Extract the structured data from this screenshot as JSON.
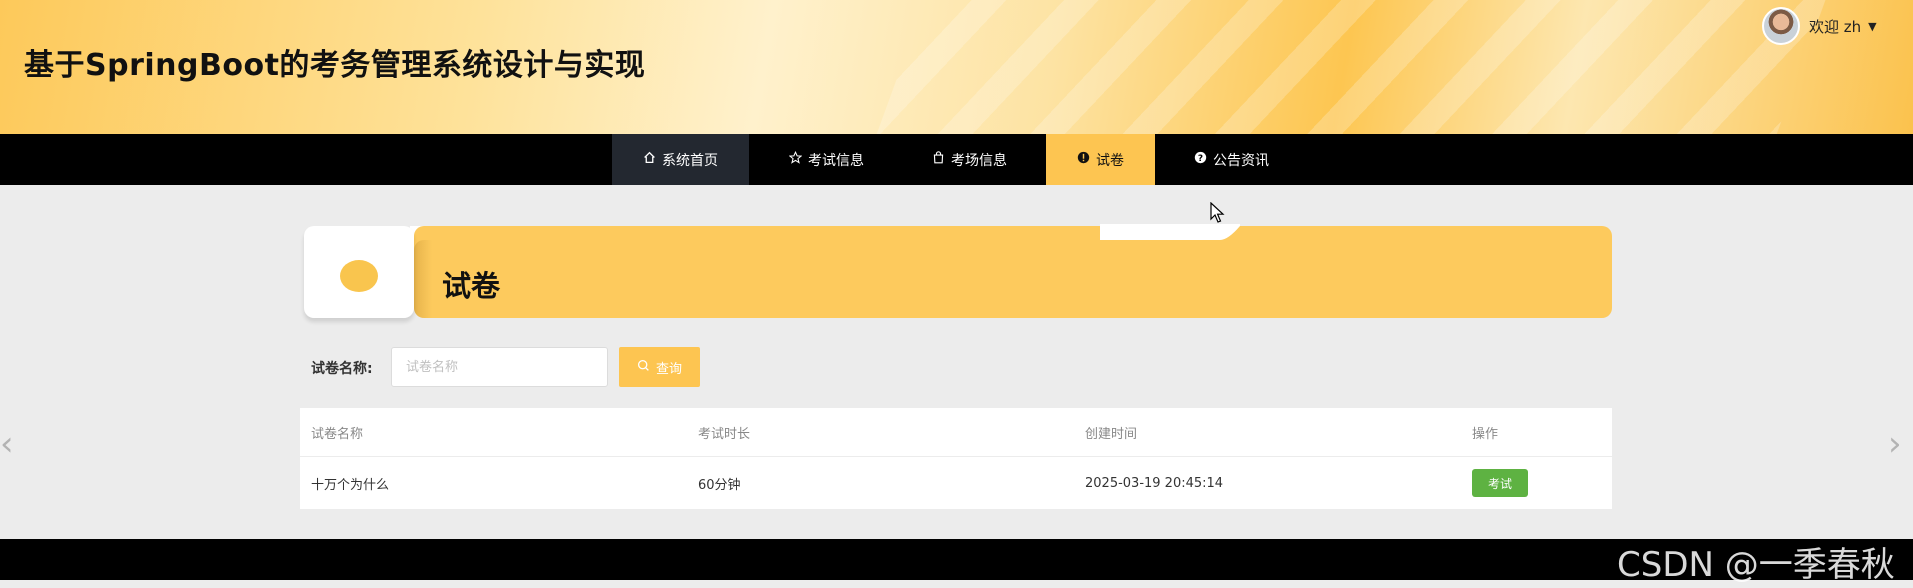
{
  "header": {
    "title": "基于SpringBoot的考务管理系统设计与实现",
    "welcome_text": "欢迎 zh",
    "caret": "▼"
  },
  "nav": {
    "items": [
      {
        "label": "系统首页",
        "icon": "home-icon"
      },
      {
        "label": "考试信息",
        "icon": "star-icon"
      },
      {
        "label": "考场信息",
        "icon": "bag-icon"
      },
      {
        "label": "试卷",
        "icon": "alert-icon"
      },
      {
        "label": "公告资讯",
        "icon": "question-icon"
      }
    ],
    "active_index": 3
  },
  "banner": {
    "title": "试卷"
  },
  "search": {
    "label": "试卷名称:",
    "placeholder": "试卷名称",
    "button_label": "查询",
    "button_icon": "search-icon"
  },
  "table": {
    "headers": [
      "试卷名称",
      "考试时长",
      "创建时间",
      "操作"
    ],
    "rows": [
      {
        "name": "十万个为什么",
        "duration": "60分钟",
        "created": "2025-03-19 20:45:14",
        "action": "考试"
      }
    ]
  },
  "arrows": {
    "left": "‹",
    "right": "›"
  },
  "watermark": "CSDN @一季春秋",
  "colors": {
    "accent": "#fdc551",
    "nav_bg": "#000000",
    "exam_button": "#5eb242"
  }
}
